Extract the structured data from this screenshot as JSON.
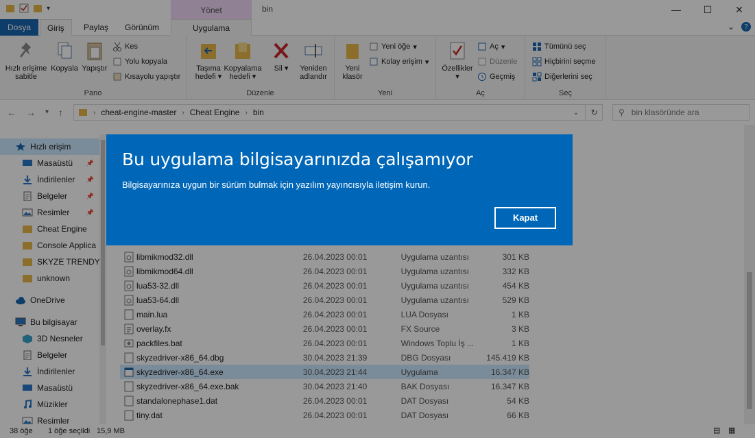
{
  "window": {
    "title": "bin",
    "context_tab": "Yönet",
    "controls": [
      "—",
      "☐",
      "✕"
    ]
  },
  "ribbon_tabs": [
    {
      "label": "Dosya"
    },
    {
      "label": "Giriş"
    },
    {
      "label": "Paylaş"
    },
    {
      "label": "Görünüm"
    },
    {
      "label": "Uygulama Araçları"
    }
  ],
  "ribbon": {
    "pano": {
      "label": "Pano",
      "pin": "Hızlı erişime sabitle",
      "copy": "Kopyala",
      "paste": "Yapıştır",
      "cut": "Kes",
      "copy_path": "Yolu kopyala",
      "paste_shortcut": "Kısayolu yapıştır"
    },
    "duzenle": {
      "label": "Düzenle",
      "move_to": "Taşıma hedefi",
      "copy_to": "Kopyalama hedefi",
      "delete": "Sil",
      "rename": "Yeniden adlandır"
    },
    "yeni": {
      "label": "Yeni",
      "new_folder": "Yeni klasör",
      "new_item": "Yeni öğe",
      "easy_access": "Kolay erişim"
    },
    "ac": {
      "label": "Aç",
      "properties": "Özellikler",
      "open": "Aç",
      "edit": "Düzenle",
      "history": "Geçmiş"
    },
    "sec": {
      "label": "Seç",
      "select_all": "Tümünü seç",
      "select_none": "Hiçbirini seçme",
      "invert": "Diğerlerini seç"
    }
  },
  "address": {
    "crumbs": [
      "cheat-engine-master",
      "Cheat Engine",
      "bin"
    ],
    "search_placeholder": "bin klasöründe ara"
  },
  "sidebar": {
    "items": [
      {
        "label": "Hızlı erişim",
        "icon": "star-icon",
        "pinned": false,
        "selected": true
      },
      {
        "label": "Masaüstü",
        "icon": "desktop-icon",
        "pinned": true
      },
      {
        "label": "İndirilenler",
        "icon": "download-icon",
        "pinned": true
      },
      {
        "label": "Belgeler",
        "icon": "documents-icon",
        "pinned": true
      },
      {
        "label": "Resimler",
        "icon": "pictures-icon",
        "pinned": true
      },
      {
        "label": "Cheat Engine",
        "icon": "folder-icon"
      },
      {
        "label": "Console Applica",
        "icon": "folder-icon"
      },
      {
        "label": "SKYZE TRENDYO",
        "icon": "folder-icon"
      },
      {
        "label": "unknown",
        "icon": "folder-icon"
      },
      {
        "label": "OneDrive",
        "icon": "cloud-icon"
      },
      {
        "label": "Bu bilgisayar",
        "icon": "computer-icon"
      },
      {
        "label": "3D Nesneler",
        "icon": "3d-icon"
      },
      {
        "label": "Belgeler",
        "icon": "documents-icon"
      },
      {
        "label": "İndirilenler",
        "icon": "download-icon"
      },
      {
        "label": "Masaüstü",
        "icon": "desktop-icon"
      },
      {
        "label": "Müzikler",
        "icon": "music-icon"
      },
      {
        "label": "Resimler",
        "icon": "pictures-icon"
      }
    ]
  },
  "files": [
    {
      "name": "libmikmod32.dll",
      "date": "26.04.2023 00:01",
      "type": "Uygulama uzantısı",
      "size": "301 KB",
      "icon": "dll-icon"
    },
    {
      "name": "libmikmod64.dll",
      "date": "26.04.2023 00:01",
      "type": "Uygulama uzantısı",
      "size": "332 KB",
      "icon": "dll-icon"
    },
    {
      "name": "lua53-32.dll",
      "date": "26.04.2023 00:01",
      "type": "Uygulama uzantısı",
      "size": "454 KB",
      "icon": "dll-icon"
    },
    {
      "name": "lua53-64.dll",
      "date": "26.04.2023 00:01",
      "type": "Uygulama uzantısı",
      "size": "529 KB",
      "icon": "dll-icon"
    },
    {
      "name": "main.lua",
      "date": "26.04.2023 00:01",
      "type": "LUA Dosyası",
      "size": "1 KB",
      "icon": "file-icon"
    },
    {
      "name": "overlay.fx",
      "date": "26.04.2023 00:01",
      "type": "FX Source",
      "size": "3 KB",
      "icon": "fx-icon"
    },
    {
      "name": "packfiles.bat",
      "date": "26.04.2023 00:01",
      "type": "Windows Toplu İş ...",
      "size": "1 KB",
      "icon": "bat-icon"
    },
    {
      "name": "skyzedriver-x86_64.dbg",
      "date": "30.04.2023 21:39",
      "type": "DBG Dosyası",
      "size": "145.419 KB",
      "icon": "file-icon"
    },
    {
      "name": "skyzedriver-x86_64.exe",
      "date": "30.04.2023 21:44",
      "type": "Uygulama",
      "size": "16.347 KB",
      "icon": "exe-icon",
      "selected": true
    },
    {
      "name": "skyzedriver-x86_64.exe.bak",
      "date": "30.04.2023 21:40",
      "type": "BAK Dosyası",
      "size": "16.347 KB",
      "icon": "file-icon"
    },
    {
      "name": "standalonephase1.dat",
      "date": "26.04.2023 00:01",
      "type": "DAT Dosyası",
      "size": "54 KB",
      "icon": "file-icon"
    },
    {
      "name": "tiny.dat",
      "date": "26.04.2023 00:01",
      "type": "DAT Dosyası",
      "size": "66 KB",
      "icon": "file-icon"
    }
  ],
  "status": {
    "count": "38 öğe",
    "selected": "1 öğe seçildi",
    "size": "15,9 MB"
  },
  "dialog": {
    "title": "Bu uygulama bilgisayarınızda çalışamıyor",
    "message": "Bilgisayarınıza uygun bir sürüm bulmak için yazılım yayıncısıyla iletişim kurun.",
    "button": "Kapat",
    "color": "#0067b8"
  }
}
